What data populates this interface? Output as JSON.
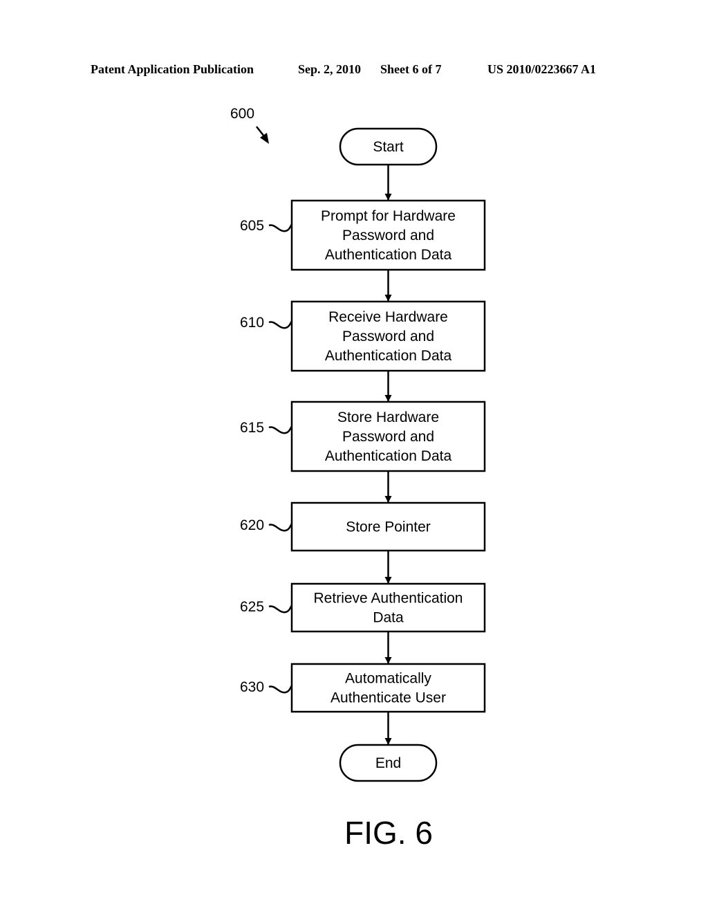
{
  "header": {
    "publication": "Patent Application Publication",
    "date": "Sep. 2, 2010",
    "sheet": "Sheet 6 of 7",
    "number": "US 2010/0223667 A1"
  },
  "diagram": {
    "ref": "600",
    "start": "Start",
    "end": "End",
    "steps": [
      {
        "ref": "605",
        "lines": [
          "Prompt for Hardware",
          "Password and",
          "Authentication Data"
        ]
      },
      {
        "ref": "610",
        "lines": [
          "Receive Hardware",
          "Password and",
          "Authentication Data"
        ]
      },
      {
        "ref": "615",
        "lines": [
          "Store Hardware",
          "Password and",
          "Authentication Data"
        ]
      },
      {
        "ref": "620",
        "lines": [
          "Store Pointer"
        ]
      },
      {
        "ref": "625",
        "lines": [
          "Retrieve Authentication",
          "Data"
        ]
      },
      {
        "ref": "630",
        "lines": [
          "Automatically",
          "Authenticate User"
        ]
      }
    ],
    "figure_label": "FIG. 6"
  }
}
